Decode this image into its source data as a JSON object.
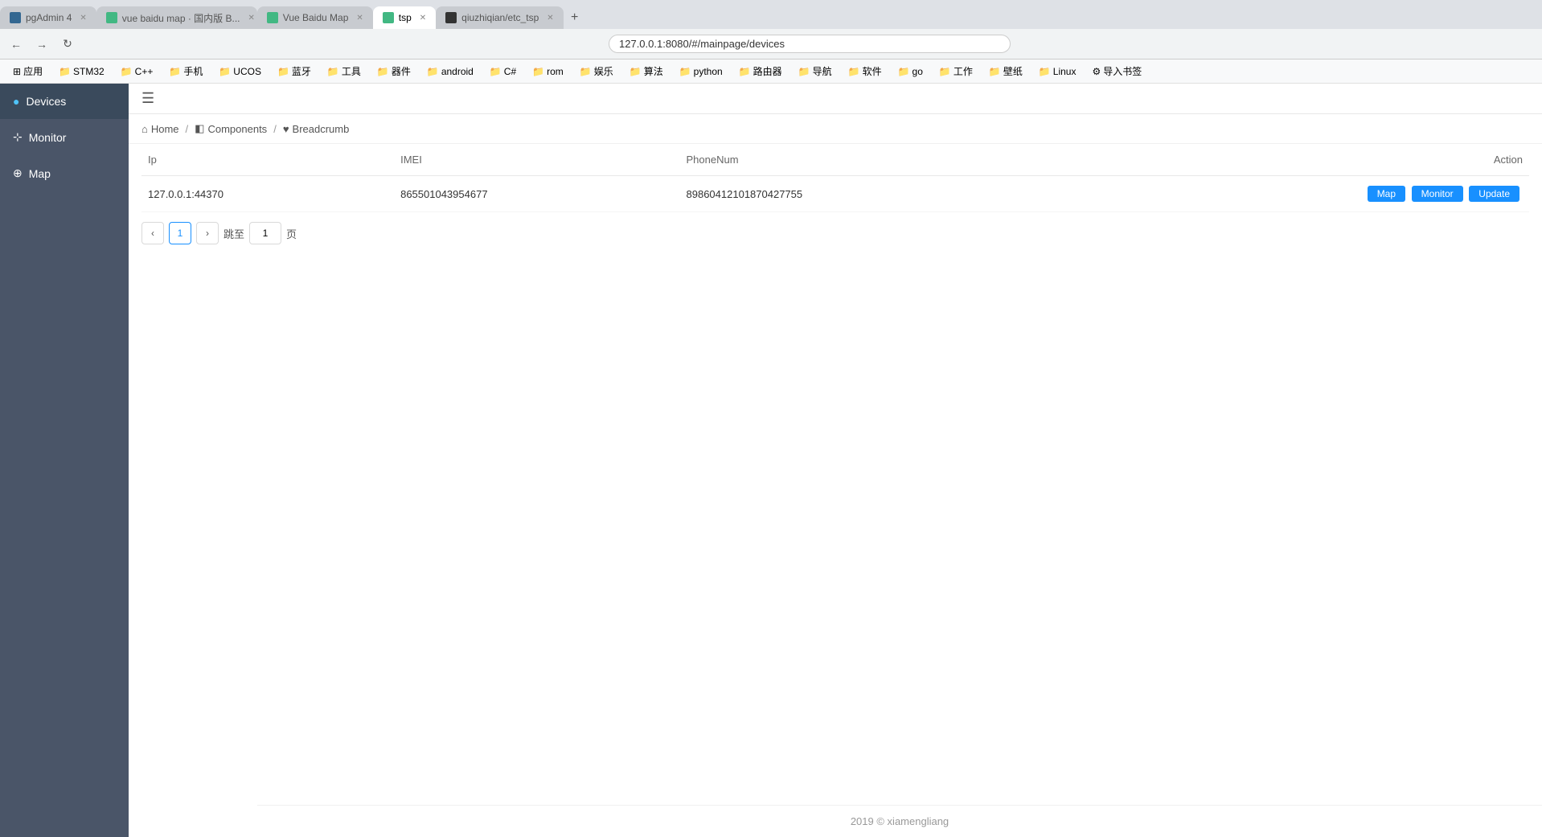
{
  "browser": {
    "tabs": [
      {
        "id": "tab-pgadmin",
        "label": "pgAdmin 4",
        "favicon_color": "#336791",
        "active": false
      },
      {
        "id": "tab-vue-baidu",
        "label": "vue baidu map · 国内版 B...",
        "favicon_color": "#42b883",
        "active": false
      },
      {
        "id": "tab-vue-baidu-map",
        "label": "Vue Baidu Map",
        "favicon_color": "#42b883",
        "active": false
      },
      {
        "id": "tab-tsp",
        "label": "tsp",
        "favicon_color": "#42b883",
        "active": true
      },
      {
        "id": "tab-github",
        "label": "qiuzhiqian/etc_tsp",
        "favicon_color": "#333",
        "active": false
      }
    ],
    "address": "127.0.0.1:8080/#/mainpage/devices",
    "bookmarks": [
      {
        "label": "应用",
        "icon": "⊞"
      },
      {
        "label": "STM32"
      },
      {
        "label": "C++"
      },
      {
        "label": "手机"
      },
      {
        "label": "UCOS"
      },
      {
        "label": "蓝牙"
      },
      {
        "label": "工具"
      },
      {
        "label": "器件"
      },
      {
        "label": "android"
      },
      {
        "label": "C#"
      },
      {
        "label": "rom"
      },
      {
        "label": "娱乐"
      },
      {
        "label": "算法"
      },
      {
        "label": "python"
      },
      {
        "label": "路由器"
      },
      {
        "label": "导航"
      },
      {
        "label": "软件"
      },
      {
        "label": "go"
      },
      {
        "label": "工作"
      },
      {
        "label": "壁纸"
      },
      {
        "label": "Linux"
      },
      {
        "label": "导入书签"
      }
    ]
  },
  "sidebar": {
    "items": [
      {
        "id": "devices",
        "label": "Devices",
        "icon": "●",
        "active": true
      },
      {
        "id": "monitor",
        "label": "Monitor",
        "icon": "⊹",
        "active": false
      },
      {
        "id": "map",
        "label": "Map",
        "icon": "⊕",
        "active": false
      }
    ]
  },
  "breadcrumb": {
    "items": [
      {
        "label": "Home",
        "icon": "⌂"
      },
      {
        "label": "Components",
        "icon": "◧"
      },
      {
        "label": "Breadcrumb",
        "icon": "♥"
      }
    ]
  },
  "table": {
    "columns": [
      {
        "key": "ip",
        "label": "Ip"
      },
      {
        "key": "imei",
        "label": "IMEI"
      },
      {
        "key": "phonenum",
        "label": "PhoneNum"
      },
      {
        "key": "action",
        "label": "Action"
      }
    ],
    "rows": [
      {
        "ip": "127.0.0.1:44370",
        "imei": "865501043954677",
        "phonenum": "89860412101870427755",
        "actions": [
          {
            "label": "Map",
            "class": "btn-map"
          },
          {
            "label": "Monitor",
            "class": "btn-monitor"
          },
          {
            "label": "Update",
            "class": "btn-update"
          }
        ]
      }
    ]
  },
  "pagination": {
    "prev_label": "‹",
    "next_label": "›",
    "current_page": "1",
    "jump_label": "跳至",
    "page_label": "页",
    "total_pages": "1"
  },
  "footer": {
    "text": "2019 © xiamengliang"
  },
  "topbar": {
    "hamburger": "☰"
  }
}
